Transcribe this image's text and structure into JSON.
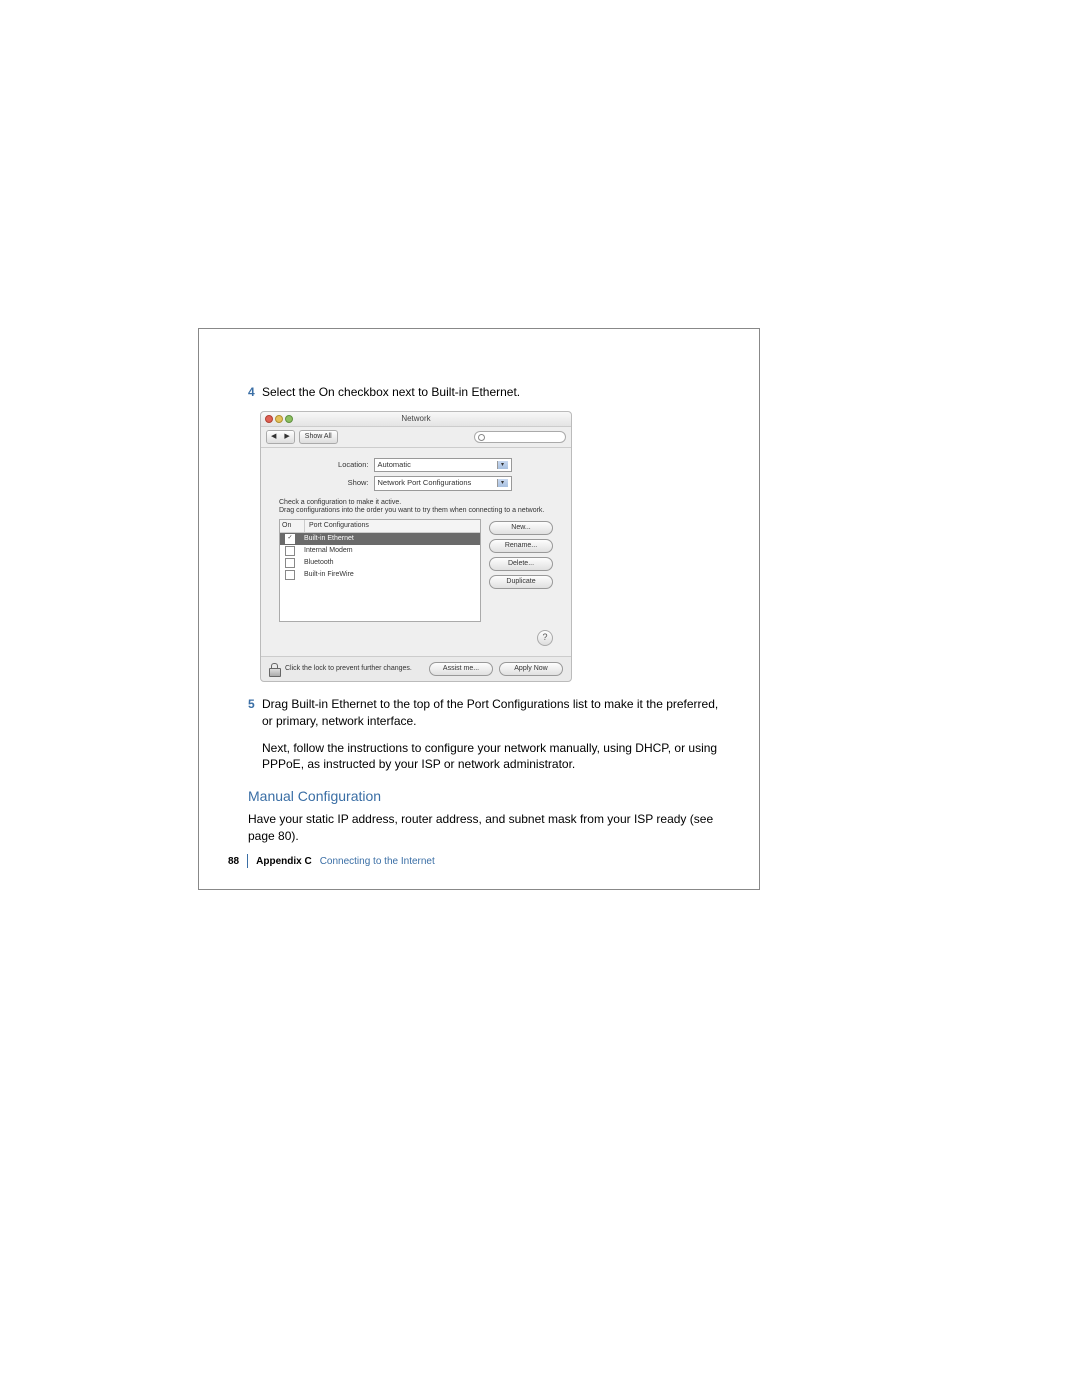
{
  "step4": {
    "num": "4",
    "text": "Select the On checkbox next to Built-in Ethernet."
  },
  "window": {
    "title": "Network",
    "showall": "Show All",
    "location_label": "Location:",
    "location_value": "Automatic",
    "show_label": "Show:",
    "show_value": "Network Port Configurations",
    "instr": "Check a configuration to make it active.\nDrag configurations into the order you want to try them when connecting to a network.",
    "col_on": "On",
    "col_name": "Port Configurations",
    "rows": [
      {
        "checked": true,
        "name": "Built-in Ethernet",
        "selected": true
      },
      {
        "checked": false,
        "name": "Internal Modem",
        "selected": false
      },
      {
        "checked": false,
        "name": "Bluetooth",
        "selected": false
      },
      {
        "checked": false,
        "name": "Built-in FireWire",
        "selected": false
      }
    ],
    "btn_new": "New...",
    "btn_rename": "Rename...",
    "btn_delete": "Delete...",
    "btn_duplicate": "Duplicate",
    "lock_text": "Click the lock to prevent further changes.",
    "btn_assist": "Assist me...",
    "btn_apply": "Apply Now",
    "help": "?"
  },
  "step5": {
    "num": "5",
    "text": "Drag Built-in Ethernet to the top of the Port Configurations list to make it the preferred, or primary, network interface."
  },
  "para_next": "Next, follow the instructions to configure your network manually, using DHCP, or using PPPoE, as instructed by your ISP or network administrator.",
  "section_head": "Manual Configuration",
  "para_manual": "Have your static IP address, router address, and subnet mask from your ISP ready (see page 80).",
  "footer": {
    "page": "88",
    "appendix": "Appendix C",
    "title": "Connecting to the Internet"
  }
}
